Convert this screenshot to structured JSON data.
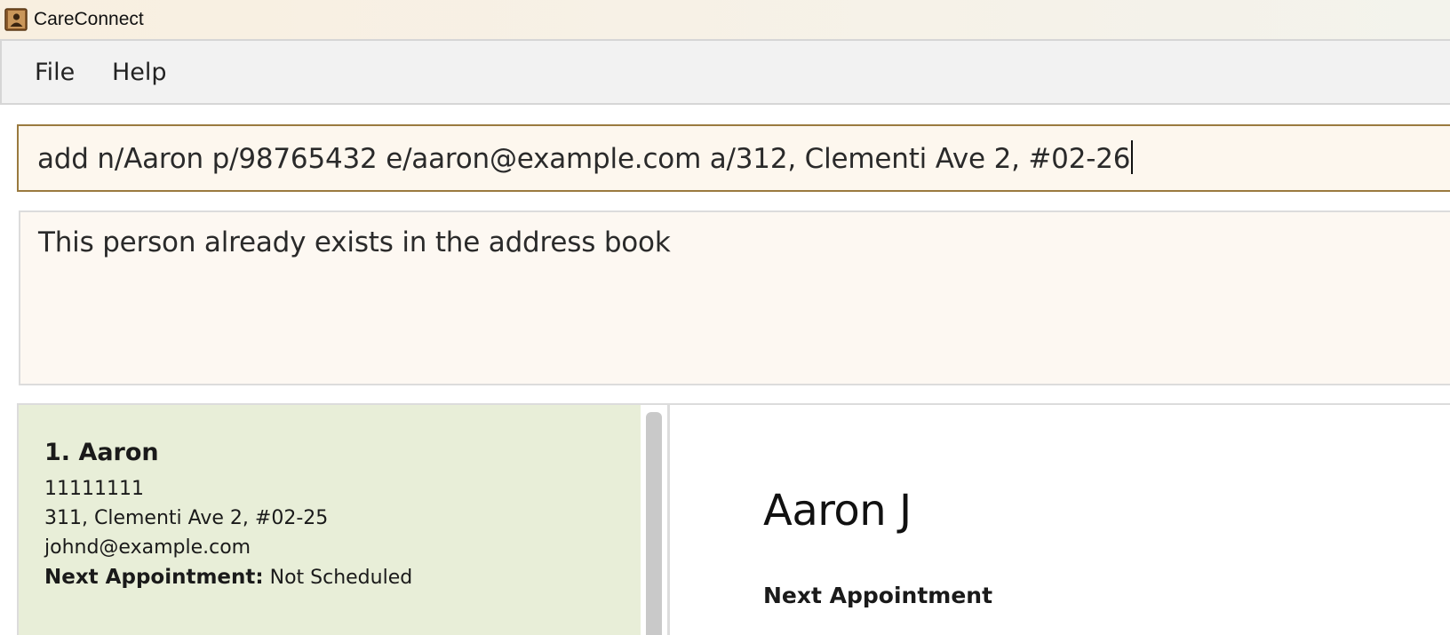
{
  "window": {
    "title": "CareConnect",
    "icon": "address-book-icon"
  },
  "menu": {
    "file_label": "File",
    "help_label": "Help"
  },
  "command": {
    "value": "add n/Aaron p/98765432 e/aaron@example.com a/312, Clementi Ave 2, #02-26"
  },
  "result": {
    "message": "This person already exists in the address book"
  },
  "person_list": {
    "items": [
      {
        "index_name": "1. Aaron",
        "phone": "11111111",
        "address": "311, Clementi Ave 2, #02-25",
        "email": "johnd@example.com",
        "appointment_label": "Next Appointment:",
        "appointment_value": "Not Scheduled"
      }
    ]
  },
  "detail": {
    "name": "Aaron J",
    "appointment_heading": "Next Appointment"
  },
  "colors": {
    "command_border": "#9a7a3f",
    "command_bg": "#fdf7ee",
    "result_bg": "#fdf8f2",
    "card_bg": "#e8eed8",
    "menubar_bg": "#f2f2f2"
  }
}
